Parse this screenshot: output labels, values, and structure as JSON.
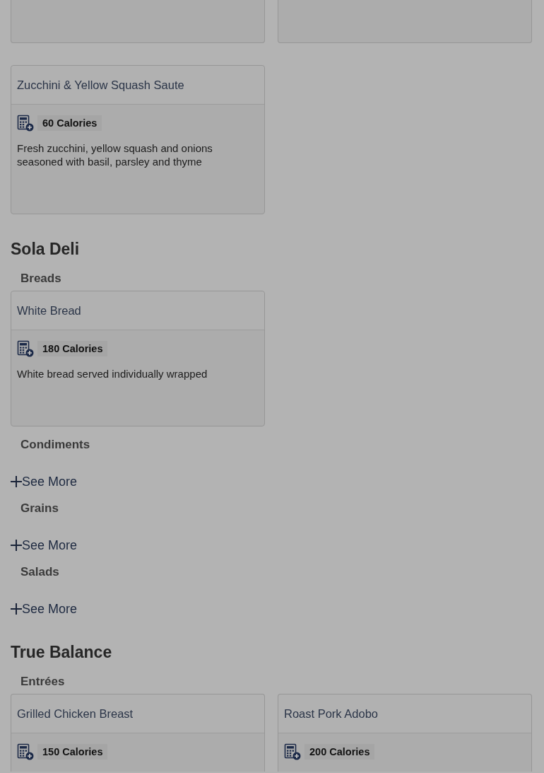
{
  "sections": [
    {
      "groups": [
        {
          "items": [
            {
              "kind": "partial_top"
            },
            {
              "kind": "partial_top"
            },
            {
              "kind": "full",
              "name": "Zucchini & Yellow Squash Saute",
              "calories": "60 Calories",
              "description": "Fresh zucchini, yellow squash and onions seasoned with basil, parsley and thyme"
            }
          ]
        }
      ]
    },
    {
      "title": "Sola Deli",
      "groups": [
        {
          "title": "Breads",
          "items": [
            {
              "kind": "full",
              "name": "White Bread",
              "calories": "180 Calories",
              "description": "White bread served individually wrapped"
            }
          ]
        },
        {
          "title": "Condiments",
          "see_more": "See More"
        },
        {
          "title": "Grains",
          "see_more": "See More"
        },
        {
          "title": "Salads",
          "see_more": "See More"
        }
      ]
    },
    {
      "title": "True Balance",
      "groups": [
        {
          "title": "Entrées",
          "items": [
            {
              "kind": "partial_bottom",
              "name": "Grilled Chicken Breast",
              "calories": "150 Calories"
            },
            {
              "kind": "partial_bottom",
              "name": "Roast Pork Adobo",
              "calories": "200 Calories"
            }
          ]
        }
      ]
    }
  ]
}
